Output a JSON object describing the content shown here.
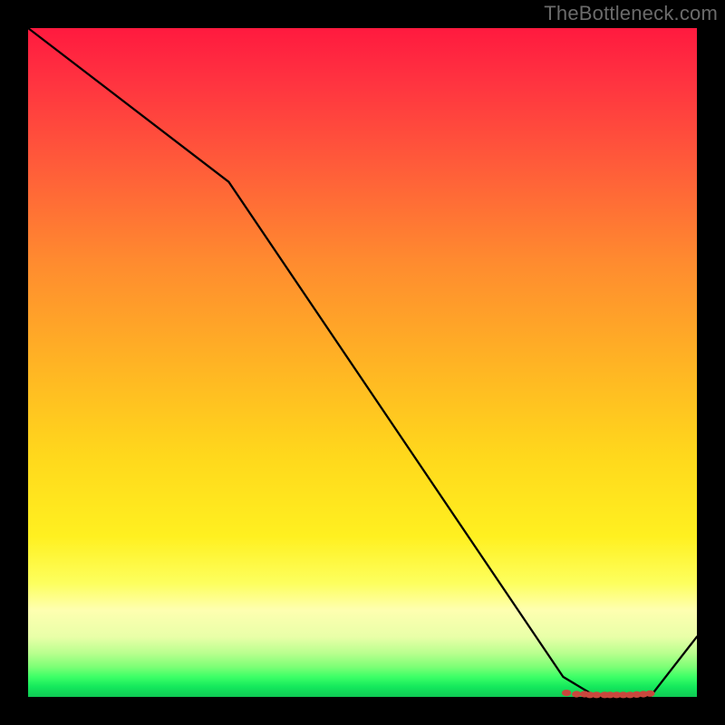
{
  "watermark": "TheBottleneck.com",
  "chart_data": {
    "type": "line",
    "title": "",
    "xlabel": "",
    "ylabel": "",
    "xlim": [
      0,
      100
    ],
    "ylim": [
      0,
      100
    ],
    "grid": false,
    "legend": false,
    "series": [
      {
        "name": "curve",
        "x": [
          0,
          30,
          80,
          85,
          93,
          100
        ],
        "y": [
          100,
          77,
          3,
          0,
          0,
          9
        ]
      }
    ],
    "markers": {
      "name": "floor-cluster",
      "color": "#c9473d",
      "points_x": [
        80.5,
        82,
        83.2,
        84,
        85,
        86.2,
        87,
        88,
        89,
        90,
        91,
        92,
        93
      ],
      "points_y": [
        0.6,
        0.4,
        0.4,
        0.3,
        0.3,
        0.3,
        0.3,
        0.3,
        0.3,
        0.3,
        0.35,
        0.4,
        0.5
      ]
    },
    "gradient_stops": [
      {
        "pos": 0.0,
        "color": "#ff1a3f"
      },
      {
        "pos": 0.5,
        "color": "#ffb324"
      },
      {
        "pos": 0.8,
        "color": "#fff020"
      },
      {
        "pos": 0.9,
        "color": "#feffb0"
      },
      {
        "pos": 1.0,
        "color": "#0fc954"
      }
    ]
  }
}
